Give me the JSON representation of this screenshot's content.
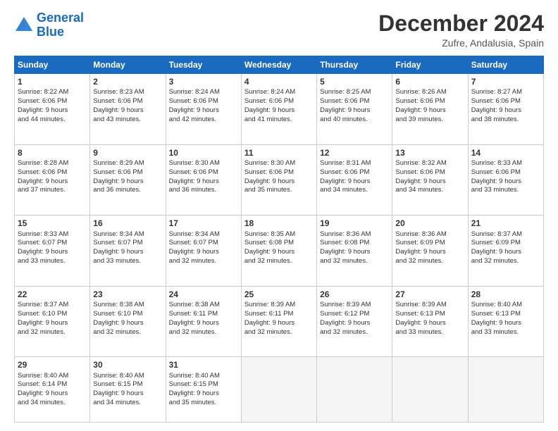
{
  "header": {
    "logo_line1": "General",
    "logo_line2": "Blue",
    "month_title": "December 2024",
    "subtitle": "Zufre, Andalusia, Spain"
  },
  "days_of_week": [
    "Sunday",
    "Monday",
    "Tuesday",
    "Wednesday",
    "Thursday",
    "Friday",
    "Saturday"
  ],
  "weeks": [
    [
      {
        "day": 1,
        "lines": [
          "Sunrise: 8:22 AM",
          "Sunset: 6:06 PM",
          "Daylight: 9 hours",
          "and 44 minutes."
        ]
      },
      {
        "day": 2,
        "lines": [
          "Sunrise: 8:23 AM",
          "Sunset: 6:06 PM",
          "Daylight: 9 hours",
          "and 43 minutes."
        ]
      },
      {
        "day": 3,
        "lines": [
          "Sunrise: 8:24 AM",
          "Sunset: 6:06 PM",
          "Daylight: 9 hours",
          "and 42 minutes."
        ]
      },
      {
        "day": 4,
        "lines": [
          "Sunrise: 8:24 AM",
          "Sunset: 6:06 PM",
          "Daylight: 9 hours",
          "and 41 minutes."
        ]
      },
      {
        "day": 5,
        "lines": [
          "Sunrise: 8:25 AM",
          "Sunset: 6:06 PM",
          "Daylight: 9 hours",
          "and 40 minutes."
        ]
      },
      {
        "day": 6,
        "lines": [
          "Sunrise: 8:26 AM",
          "Sunset: 6:06 PM",
          "Daylight: 9 hours",
          "and 39 minutes."
        ]
      },
      {
        "day": 7,
        "lines": [
          "Sunrise: 8:27 AM",
          "Sunset: 6:06 PM",
          "Daylight: 9 hours",
          "and 38 minutes."
        ]
      }
    ],
    [
      {
        "day": 8,
        "lines": [
          "Sunrise: 8:28 AM",
          "Sunset: 6:06 PM",
          "Daylight: 9 hours",
          "and 37 minutes."
        ]
      },
      {
        "day": 9,
        "lines": [
          "Sunrise: 8:29 AM",
          "Sunset: 6:06 PM",
          "Daylight: 9 hours",
          "and 36 minutes."
        ]
      },
      {
        "day": 10,
        "lines": [
          "Sunrise: 8:30 AM",
          "Sunset: 6:06 PM",
          "Daylight: 9 hours",
          "and 36 minutes."
        ]
      },
      {
        "day": 11,
        "lines": [
          "Sunrise: 8:30 AM",
          "Sunset: 6:06 PM",
          "Daylight: 9 hours",
          "and 35 minutes."
        ]
      },
      {
        "day": 12,
        "lines": [
          "Sunrise: 8:31 AM",
          "Sunset: 6:06 PM",
          "Daylight: 9 hours",
          "and 34 minutes."
        ]
      },
      {
        "day": 13,
        "lines": [
          "Sunrise: 8:32 AM",
          "Sunset: 6:06 PM",
          "Daylight: 9 hours",
          "and 34 minutes."
        ]
      },
      {
        "day": 14,
        "lines": [
          "Sunrise: 8:33 AM",
          "Sunset: 6:06 PM",
          "Daylight: 9 hours",
          "and 33 minutes."
        ]
      }
    ],
    [
      {
        "day": 15,
        "lines": [
          "Sunrise: 8:33 AM",
          "Sunset: 6:07 PM",
          "Daylight: 9 hours",
          "and 33 minutes."
        ]
      },
      {
        "day": 16,
        "lines": [
          "Sunrise: 8:34 AM",
          "Sunset: 6:07 PM",
          "Daylight: 9 hours",
          "and 33 minutes."
        ]
      },
      {
        "day": 17,
        "lines": [
          "Sunrise: 8:34 AM",
          "Sunset: 6:07 PM",
          "Daylight: 9 hours",
          "and 32 minutes."
        ]
      },
      {
        "day": 18,
        "lines": [
          "Sunrise: 8:35 AM",
          "Sunset: 6:08 PM",
          "Daylight: 9 hours",
          "and 32 minutes."
        ]
      },
      {
        "day": 19,
        "lines": [
          "Sunrise: 8:36 AM",
          "Sunset: 6:08 PM",
          "Daylight: 9 hours",
          "and 32 minutes."
        ]
      },
      {
        "day": 20,
        "lines": [
          "Sunrise: 8:36 AM",
          "Sunset: 6:09 PM",
          "Daylight: 9 hours",
          "and 32 minutes."
        ]
      },
      {
        "day": 21,
        "lines": [
          "Sunrise: 8:37 AM",
          "Sunset: 6:09 PM",
          "Daylight: 9 hours",
          "and 32 minutes."
        ]
      }
    ],
    [
      {
        "day": 22,
        "lines": [
          "Sunrise: 8:37 AM",
          "Sunset: 6:10 PM",
          "Daylight: 9 hours",
          "and 32 minutes."
        ]
      },
      {
        "day": 23,
        "lines": [
          "Sunrise: 8:38 AM",
          "Sunset: 6:10 PM",
          "Daylight: 9 hours",
          "and 32 minutes."
        ]
      },
      {
        "day": 24,
        "lines": [
          "Sunrise: 8:38 AM",
          "Sunset: 6:11 PM",
          "Daylight: 9 hours",
          "and 32 minutes."
        ]
      },
      {
        "day": 25,
        "lines": [
          "Sunrise: 8:39 AM",
          "Sunset: 6:11 PM",
          "Daylight: 9 hours",
          "and 32 minutes."
        ]
      },
      {
        "day": 26,
        "lines": [
          "Sunrise: 8:39 AM",
          "Sunset: 6:12 PM",
          "Daylight: 9 hours",
          "and 32 minutes."
        ]
      },
      {
        "day": 27,
        "lines": [
          "Sunrise: 8:39 AM",
          "Sunset: 6:13 PM",
          "Daylight: 9 hours",
          "and 33 minutes."
        ]
      },
      {
        "day": 28,
        "lines": [
          "Sunrise: 8:40 AM",
          "Sunset: 6:13 PM",
          "Daylight: 9 hours",
          "and 33 minutes."
        ]
      }
    ],
    [
      {
        "day": 29,
        "lines": [
          "Sunrise: 8:40 AM",
          "Sunset: 6:14 PM",
          "Daylight: 9 hours",
          "and 34 minutes."
        ]
      },
      {
        "day": 30,
        "lines": [
          "Sunrise: 8:40 AM",
          "Sunset: 6:15 PM",
          "Daylight: 9 hours",
          "and 34 minutes."
        ]
      },
      {
        "day": 31,
        "lines": [
          "Sunrise: 8:40 AM",
          "Sunset: 6:15 PM",
          "Daylight: 9 hours",
          "and 35 minutes."
        ]
      },
      null,
      null,
      null,
      null
    ]
  ]
}
